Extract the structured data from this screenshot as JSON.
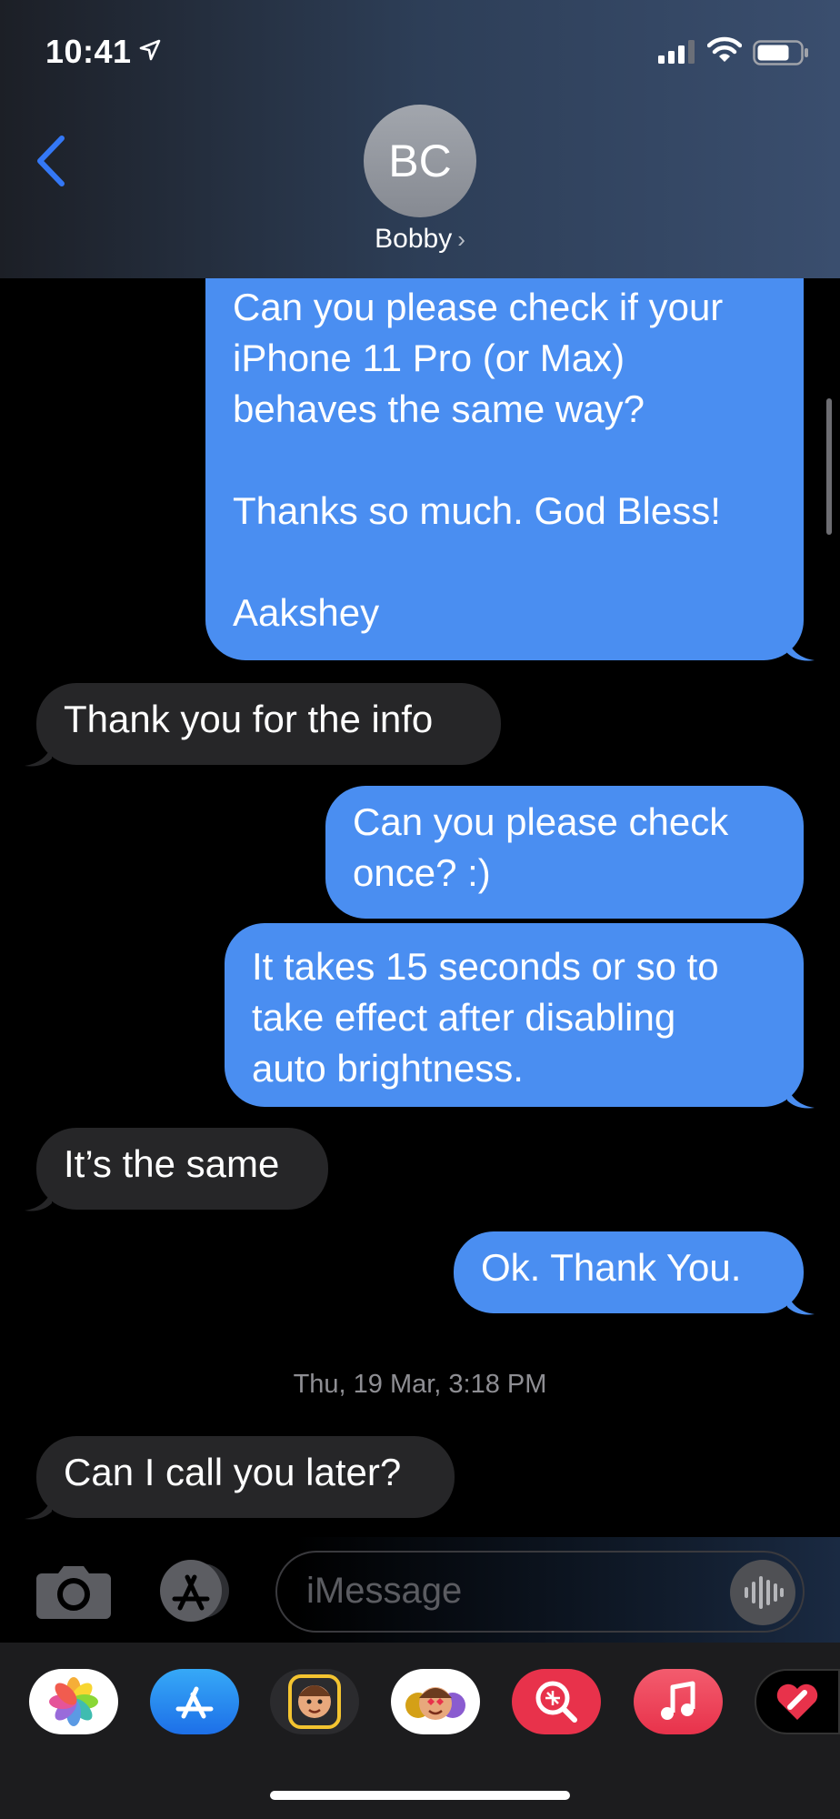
{
  "status_bar": {
    "time": "10:41"
  },
  "contact": {
    "initials": "BC",
    "name": "Bobby"
  },
  "messages": [
    {
      "from": "me",
      "text": "Can you please check if your\niPhone 11 Pro (or Max)\nbehaves the same way?\n\nThanks so much. God Bless!\n\nAakshey"
    },
    {
      "from": "them",
      "text": "Thank you for the info"
    },
    {
      "from": "me",
      "text": "Can you please check\nonce? :)"
    },
    {
      "from": "me",
      "text": "It takes 15 seconds or so to\ntake effect after disabling\nauto brightness."
    },
    {
      "from": "them",
      "text": "It’s the same"
    },
    {
      "from": "me",
      "text": "Ok. Thank You."
    },
    {
      "from": "them",
      "text": "Can I call you later?"
    }
  ],
  "timestamp": "Thu, 19 Mar, 3:18 PM",
  "composer": {
    "placeholder": "iMessage"
  },
  "app_drawer": {
    "apps": [
      "photos-icon",
      "app-store-icon",
      "memoji-icon",
      "animoji-stickers-icon",
      "web-images-icon",
      "music-icon",
      "digital-touch-icon"
    ]
  },
  "colors": {
    "outgoing": "#4a8ef1",
    "incoming": "#262628",
    "accent": "#3478f6"
  }
}
